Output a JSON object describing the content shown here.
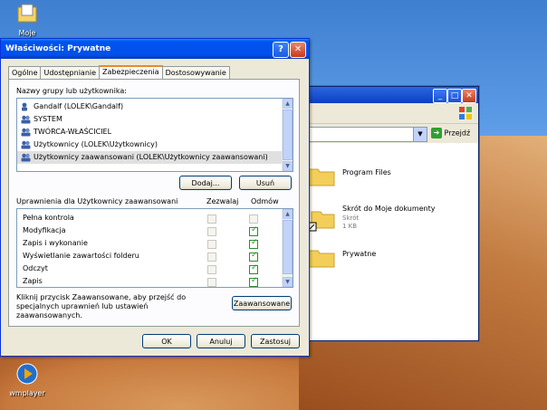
{
  "desktop": {
    "icons": [
      {
        "label": "Moje"
      },
      {
        "label": "wmplayer"
      }
    ]
  },
  "explorer": {
    "go_label": "Przejdź",
    "files": [
      {
        "name": "Program Files",
        "sub1": "",
        "sub2": ""
      },
      {
        "name": "Skrót do Moje dokumenty",
        "sub1": "Skrót",
        "sub2": "1 KB"
      },
      {
        "name": "Prywatne",
        "sub1": "",
        "sub2": ""
      }
    ]
  },
  "dialog": {
    "title": "Właściwości: Prywatne",
    "help_glyph": "?",
    "close_glyph": "✕",
    "tabs": [
      "Ogólne",
      "Udostępnianie",
      "Zabezpieczenia",
      "Dostosowywanie"
    ],
    "active_tab": "Zabezpieczenia",
    "groups_label": "Nazwy grupy lub użytkownika:",
    "groups": [
      "Gandalf (LOLEK\\Gandalf)",
      "SYSTEM",
      "TWÓRCA-WŁAŚCICIEL",
      "Użytkownicy (LOLEK\\Użytkownicy)",
      "Użytkownicy zaawansowani (LOLEK\\Użytkownicy zaawansowani)"
    ],
    "add_label": "Dodaj...",
    "remove_label": "Usuń",
    "perm_label": "Uprawnienia dla Użytkownicy zaawansowani",
    "allow_header": "Zezwalaj",
    "deny_header": "Odmów",
    "permissions": [
      {
        "name": "Pełna kontrola",
        "allow": false,
        "deny": false
      },
      {
        "name": "Modyfikacja",
        "allow": false,
        "deny": true
      },
      {
        "name": "Zapis i wykonanie",
        "allow": false,
        "deny": true
      },
      {
        "name": "Wyświetlanie zawartości folderu",
        "allow": false,
        "deny": true
      },
      {
        "name": "Odczyt",
        "allow": false,
        "deny": true
      },
      {
        "name": "Zapis",
        "allow": false,
        "deny": true
      }
    ],
    "advanced_text": "Kliknij przycisk Zaawansowane, aby przejść do specjalnych uprawnień lub ustawień zaawansowanych.",
    "advanced_label": "Zaawansowane",
    "ok_label": "OK",
    "cancel_label": "Anuluj",
    "apply_label": "Zastosuj"
  }
}
